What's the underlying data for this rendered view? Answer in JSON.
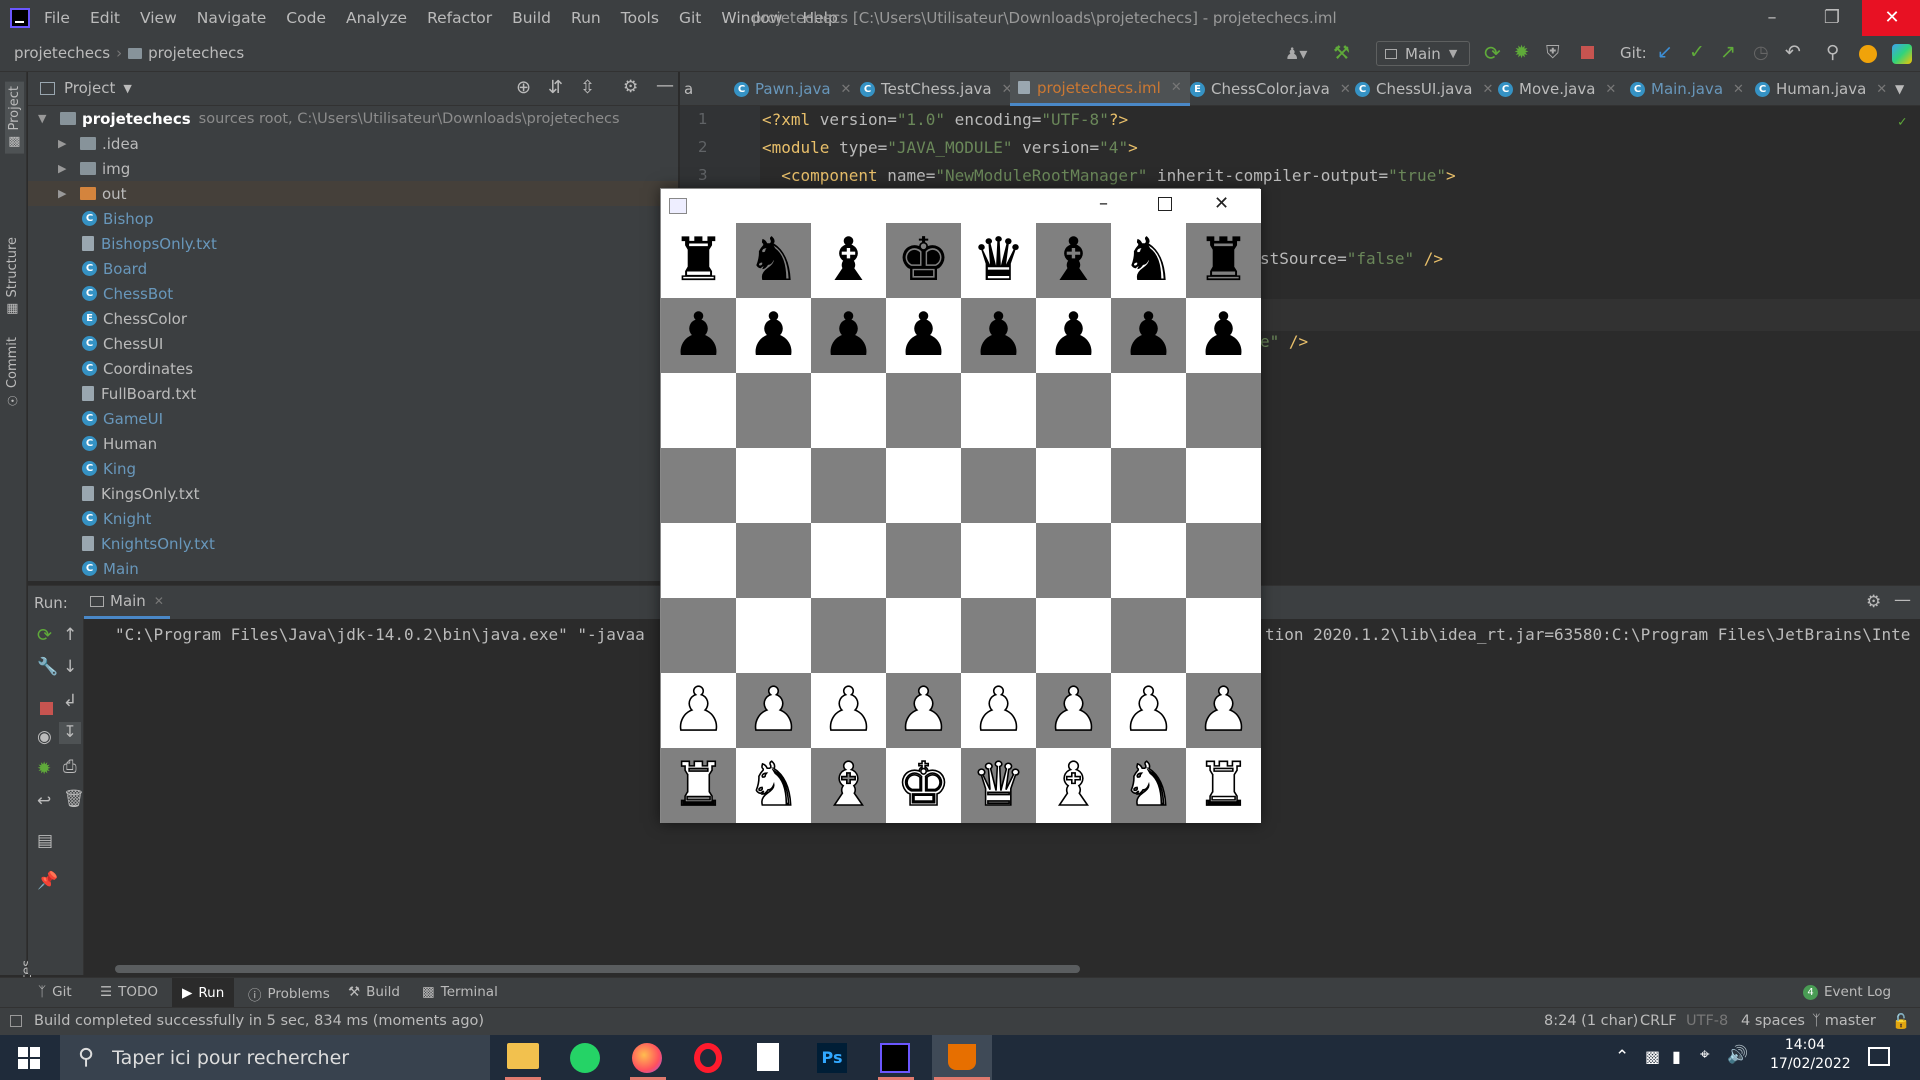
{
  "menubar": {
    "items": [
      "File",
      "Edit",
      "View",
      "Navigate",
      "Code",
      "Analyze",
      "Refactor",
      "Build",
      "Run",
      "Tools",
      "Git",
      "Window",
      "Help"
    ],
    "title": "projetechecs [C:\\Users\\Utilisateur\\Downloads\\projetechecs] - projetechecs.iml"
  },
  "navbar": {
    "breadcrumb": [
      "projetechecs",
      "projetechecs"
    ],
    "run_config": "Main",
    "git_label": "Git:"
  },
  "project": {
    "header": "Project",
    "root_name": "projetechecs",
    "root_hint": "sources root,  C:\\Users\\Utilisateur\\Downloads\\projetechecs",
    "folders": [
      ".idea",
      "img",
      "out"
    ],
    "files": [
      {
        "name": "Bishop",
        "kind": "class"
      },
      {
        "name": "BishopsOnly.txt",
        "kind": "text"
      },
      {
        "name": "Board",
        "kind": "class"
      },
      {
        "name": "ChessBot",
        "kind": "class"
      },
      {
        "name": "ChessColor",
        "kind": "enum"
      },
      {
        "name": "ChessUI",
        "kind": "class"
      },
      {
        "name": "Coordinates",
        "kind": "class"
      },
      {
        "name": "FullBoard.txt",
        "kind": "text"
      },
      {
        "name": "GameUI",
        "kind": "class"
      },
      {
        "name": "Human",
        "kind": "class"
      },
      {
        "name": "King",
        "kind": "class"
      },
      {
        "name": "KingsOnly.txt",
        "kind": "text"
      },
      {
        "name": "Knight",
        "kind": "class"
      },
      {
        "name": "KnightsOnly.txt",
        "kind": "text"
      },
      {
        "name": "Main",
        "kind": "class"
      }
    ]
  },
  "tabs": [
    {
      "label": "a"
    },
    {
      "label": "Pawn.java"
    },
    {
      "label": "TestChess.java"
    },
    {
      "label": "projetechecs.iml",
      "active": true
    },
    {
      "label": "ChessColor.java"
    },
    {
      "label": "ChessUI.java"
    },
    {
      "label": "Move.java"
    },
    {
      "label": "Main.java"
    },
    {
      "label": "Human.java"
    }
  ],
  "editor": {
    "line_numbers": [
      "1",
      "2",
      "3"
    ],
    "line1": {
      "a": "<?xml ",
      "b": "version",
      "c": "=",
      "d": "\"1.0\"",
      "e": " encoding",
      "f": "=",
      "g": "\"UTF-8\"",
      "h": "?>"
    },
    "line2": {
      "a": "<module ",
      "b": "type",
      "c": "=",
      "d": "\"JAVA_MODULE\"",
      "e": " version",
      "f": "=",
      "g": "\"4\"",
      "h": ">"
    },
    "line3": {
      "a": "  <component ",
      "b": "name",
      "c": "=",
      "d": "\"NewModuleRootManager\"",
      "e": " inherit-compiler-output",
      "f": "=",
      "g": "\"true\"",
      "h": ">"
    },
    "frag1_a": "stSource",
    "frag1_b": "=",
    "frag1_c": "\"false\"",
    "frag1_d": " />",
    "frag2_a": "e\"",
    "frag2_b": " />"
  },
  "run": {
    "label": "Run:",
    "tab": "Main",
    "output_left": "\"C:\\Program Files\\Java\\jdk-14.0.2\\bin\\java.exe\" \"-javaa",
    "output_right": "tion 2020.1.2\\lib\\idea_rt.jar=63580:C:\\Program Files\\JetBrains\\Inte"
  },
  "bottom_tabs": [
    "Git",
    "TODO",
    "Run",
    "Problems",
    "Build",
    "Terminal"
  ],
  "event_log": {
    "count": "4",
    "label": "Event Log"
  },
  "status": {
    "message": "Build completed successfully in 5 sec, 834 ms (moments ago)",
    "position": "8:24 (1 char)",
    "line_sep": "CRLF",
    "encoding": "UTF-8",
    "indent": "4 spaces",
    "branch": "master"
  },
  "taskbar": {
    "search_placeholder": "Taper ici pour rechercher",
    "time": "14:04",
    "date": "17/02/2022"
  },
  "chess": {
    "board": [
      [
        "♜",
        "♞",
        "♝",
        "♚",
        "♛",
        "♝",
        "♞",
        "♜"
      ],
      [
        "♟",
        "♟",
        "♟",
        "♟",
        "♟",
        "♟",
        "♟",
        "♟"
      ],
      [
        "",
        "",
        "",
        "",
        "",
        "",
        "",
        ""
      ],
      [
        "",
        "",
        "",
        "",
        "",
        "",
        "",
        ""
      ],
      [
        "",
        "",
        "",
        "",
        "",
        "",
        "",
        ""
      ],
      [
        "",
        "",
        "",
        "",
        "",
        "",
        "",
        ""
      ],
      [
        "♟",
        "♟",
        "♟",
        "♟",
        "♟",
        "♟",
        "♟",
        "♟"
      ],
      [
        "♜",
        "♞",
        "♝",
        "♚",
        "♛",
        "♝",
        "♞",
        "♜"
      ]
    ],
    "piece_colors": [
      "black",
      "black",
      "none",
      "none",
      "none",
      "none",
      "white",
      "white"
    ],
    "light_color": "#ffffff",
    "dark_color": "#808080"
  },
  "colors": {
    "accent": "#4a88c7",
    "close_red": "#e81123"
  }
}
